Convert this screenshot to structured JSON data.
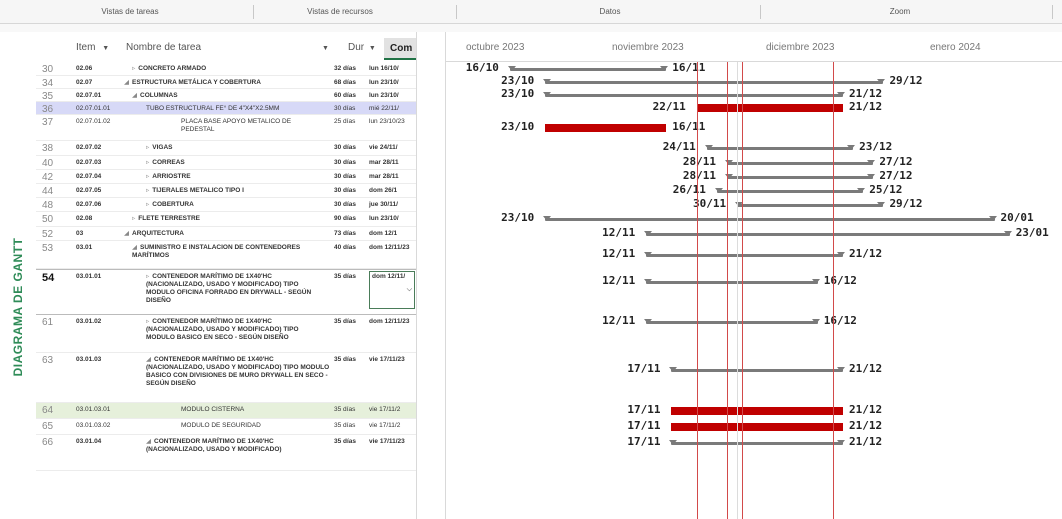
{
  "ribbon": {
    "groups": [
      "Vistas de tareas",
      "Vistas de recursos",
      "Datos",
      "Zoom"
    ]
  },
  "side_label": "DIAGRAMA DE GANTT",
  "grid": {
    "headers": {
      "item": "Item",
      "name": "Nombre de tarea",
      "dur": "Dur",
      "com": "Com"
    },
    "rows": [
      {
        "id": "30",
        "item": "02.06",
        "name": "CONCRETO ARMADO",
        "caret": "▹",
        "dur": "32 días",
        "com": "lun 16/10/"
      },
      {
        "id": "34",
        "item": "02.07",
        "name": "ESTRUCTURA METÁLICA Y COBERTURA",
        "caret": "◢",
        "dur": "68 días",
        "com": "lun 23/10/"
      },
      {
        "id": "35",
        "item": "02.07.01",
        "name": "COLUMNAS",
        "caret": "◢",
        "dur": "60 días",
        "com": "lun 23/10/"
      },
      {
        "id": "36",
        "item": "02.07.01.01",
        "name": "TUBO ESTRUCTURAL Fe° DE 4\"X4\"X2.5mm",
        "caret": "",
        "dur": "30 días",
        "com": "mié 22/11/"
      },
      {
        "id": "37",
        "item": "02.07.01.02",
        "name": "PLACA BASE APOYO METALICO DE PEDESTAL",
        "caret": "",
        "dur": "25 días",
        "com": "lun 23/10/23"
      },
      {
        "id": "38",
        "item": "02.07.02",
        "name": "VIGAS",
        "caret": "▹",
        "dur": "30 días",
        "com": "vie 24/11/"
      },
      {
        "id": "40",
        "item": "02.07.03",
        "name": "CORREAS",
        "caret": "▹",
        "dur": "30 días",
        "com": "mar 28/11"
      },
      {
        "id": "42",
        "item": "02.07.04",
        "name": "ARRIOSTRE",
        "caret": "▹",
        "dur": "30 días",
        "com": "mar 28/11"
      },
      {
        "id": "44",
        "item": "02.07.05",
        "name": "TIJERALES METALICO TIPO I",
        "caret": "▹",
        "dur": "30 días",
        "com": "dom 26/1"
      },
      {
        "id": "48",
        "item": "02.07.06",
        "name": "COBERTURA",
        "caret": "▹",
        "dur": "30 días",
        "com": "jue 30/11/"
      },
      {
        "id": "50",
        "item": "02.08",
        "name": "FLETE TERRESTRE",
        "caret": "▹",
        "dur": "90 días",
        "com": "lun 23/10/"
      },
      {
        "id": "52",
        "item": "03",
        "name": "ARQUITECTURA",
        "caret": "◢",
        "dur": "73 días",
        "com": "dom 12/1"
      },
      {
        "id": "53",
        "item": "03.01",
        "name": "SUMINISTRO E INSTALACION DE CONTENEDORES MARÍTIMOS",
        "caret": "◢",
        "dur": "40 días",
        "com": "dom 12/11/23"
      },
      {
        "id": "54",
        "item": "03.01.01",
        "name": "CONTENEDOR MARÍTIMO DE 1x40'HC (NACIONALIZADO, USADO Y MODIFICADO) TIPO MODULO OFICINA FORRADO EN DRYWALL - SEGÚN DISEÑO",
        "caret": "▹",
        "dur": "35 días",
        "com": "dom 12/11/"
      },
      {
        "id": "61",
        "item": "03.01.02",
        "name": "CONTENEDOR MARÍTIMO DE 1x40'HC (NACIONALIZADO, USADO Y MODIFICADO) TIPO MODULO BASICO EN SECO - SEGÚN DISEÑO",
        "caret": "▹",
        "dur": "35 días",
        "com": "dom 12/11/23"
      },
      {
        "id": "63",
        "item": "03.01.03",
        "name": "CONTENEDOR MARÍTIMO DE 1x40'HC (NACIONALIZADO, USADO Y MODIFICADO) TIPO MODULO BASICO CON DIVISIONES DE MURO DRYWALL EN SECO - SEGÚN DISEÑO",
        "caret": "◢",
        "dur": "35 días",
        "com": "vie 17/11/23"
      },
      {
        "id": "64",
        "item": "03.01.03.01",
        "name": "MODULO CISTERNA",
        "caret": "",
        "dur": "35 días",
        "com": "vie 17/11/2"
      },
      {
        "id": "65",
        "item": "03.01.03.02",
        "name": "MODULO DE SEGURIDAD",
        "caret": "",
        "dur": "35 días",
        "com": "vie 17/11/2"
      },
      {
        "id": "66",
        "item": "03.01.04",
        "name": "CONTENEDOR MARÍTIMO DE 1x40'HC (NACIONALIZADO, USADO Y MODIFICADO)",
        "caret": "◢",
        "dur": "35 días",
        "com": "vie 17/11/23"
      }
    ]
  },
  "timeline": {
    "months": [
      "octubre 2023",
      "noviembre 2023",
      "diciembre 2023",
      "enero 2024"
    ],
    "bars": [
      {
        "start_label": "16/10",
        "end_label": "16/11",
        "critical": false
      },
      {
        "start_label": "23/10",
        "end_label": "29/12",
        "critical": false
      },
      {
        "start_label": "23/10",
        "end_label": "21/12",
        "critical": false
      },
      {
        "start_label": "22/11",
        "end_label": "21/12",
        "critical": true
      },
      {
        "start_label": "23/10",
        "end_label": "16/11",
        "critical": true
      },
      {
        "start_label": "24/11",
        "end_label": "23/12",
        "critical": false
      },
      {
        "start_label": "28/11",
        "end_label": "27/12",
        "critical": false
      },
      {
        "start_label": "28/11",
        "end_label": "27/12",
        "critical": false
      },
      {
        "start_label": "26/11",
        "end_label": "25/12",
        "critical": false
      },
      {
        "start_label": "30/11",
        "end_label": "29/12",
        "critical": false
      },
      {
        "start_label": "23/10",
        "end_label": "20/01",
        "critical": false
      },
      {
        "start_label": "12/11",
        "end_label": "23/01",
        "critical": false
      },
      {
        "start_label": "12/11",
        "end_label": "21/12",
        "critical": false
      },
      {
        "start_label": "12/11",
        "end_label": "16/12",
        "critical": false
      },
      {
        "start_label": "12/11",
        "end_label": "16/12",
        "critical": false
      },
      {
        "start_label": "17/11",
        "end_label": "21/12",
        "critical": false
      },
      {
        "start_label": "17/11",
        "end_label": "21/12",
        "critical": true
      },
      {
        "start_label": "17/11",
        "end_label": "21/12",
        "critical": true
      },
      {
        "start_label": "17/11",
        "end_label": "21/12",
        "critical": false
      }
    ]
  }
}
